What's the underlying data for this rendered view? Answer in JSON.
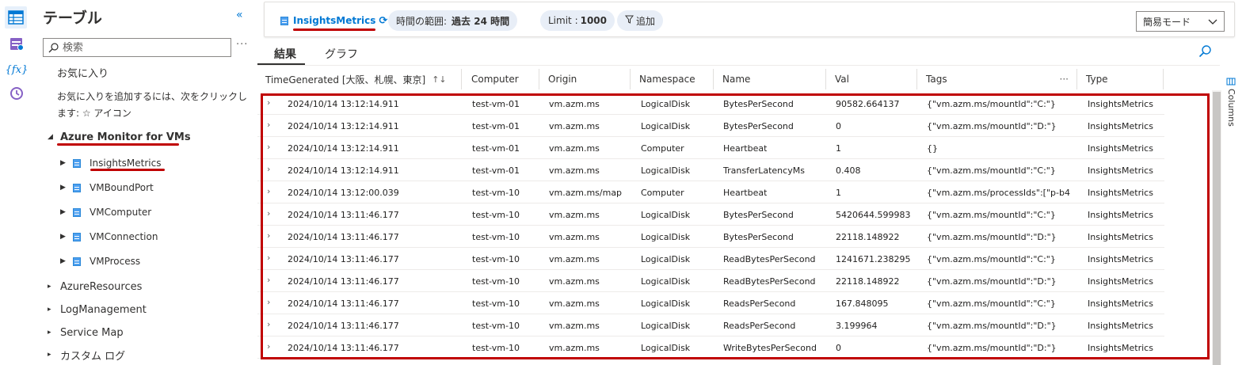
{
  "sidebar_rail": {
    "icons": [
      "tables-icon",
      "queries-icon",
      "functions-icon",
      "history-icon"
    ]
  },
  "schema_panel": {
    "title": "テーブル",
    "search_placeholder": "検索",
    "favorites_title": "お気に入り",
    "favorites_hint": "お気に入りを追加するには、次をクリックします: ☆ アイコン",
    "groups": [
      {
        "label": "Azure Monitor for VMs",
        "expanded": true,
        "tables": [
          "InsightsMetrics",
          "VMBoundPort",
          "VMComputer",
          "VMConnection",
          "VMProcess"
        ]
      },
      {
        "label": "AzureResources",
        "expanded": false
      },
      {
        "label": "LogManagement",
        "expanded": false
      },
      {
        "label": "Service Map",
        "expanded": false
      },
      {
        "label": "カスタム ログ",
        "expanded": false
      }
    ]
  },
  "toolbar": {
    "table_name": "InsightsMetrics",
    "time_range_label": "時間の範囲:",
    "time_range_value": "過去 24 時間",
    "limit_label": "Limit :",
    "limit_value": "1000",
    "add_label": "追加",
    "mode_value": "簡易モード"
  },
  "tabs": [
    "結果",
    "グラフ"
  ],
  "active_tab": "結果",
  "grid": {
    "columns": [
      "TimeGenerated [大阪、札幌、東京]",
      "Computer",
      "Origin",
      "Namespace",
      "Name",
      "Val",
      "Tags",
      "Type"
    ],
    "rows": [
      [
        "2024/10/14 13:12:14.911",
        "test-vm-01",
        "vm.azm.ms",
        "LogicalDisk",
        "BytesPerSecond",
        "90582.664137",
        "{\"vm.azm.ms/mountId\":\"C:\"}",
        "InsightsMetrics"
      ],
      [
        "2024/10/14 13:12:14.911",
        "test-vm-01",
        "vm.azm.ms",
        "LogicalDisk",
        "BytesPerSecond",
        "0",
        "{\"vm.azm.ms/mountId\":\"D:\"}",
        "InsightsMetrics"
      ],
      [
        "2024/10/14 13:12:14.911",
        "test-vm-01",
        "vm.azm.ms",
        "Computer",
        "Heartbeat",
        "1",
        "{}",
        "InsightsMetrics"
      ],
      [
        "2024/10/14 13:12:14.911",
        "test-vm-01",
        "vm.azm.ms",
        "LogicalDisk",
        "TransferLatencyMs",
        "0.408",
        "{\"vm.azm.ms/mountId\":\"C:\"}",
        "InsightsMetrics"
      ],
      [
        "2024/10/14 13:12:00.039",
        "test-vm-10",
        "vm.azm.ms/map",
        "Computer",
        "Heartbeat",
        "1",
        "{\"vm.azm.ms/processIds\":[\"p-b4...",
        "InsightsMetrics"
      ],
      [
        "2024/10/14 13:11:46.177",
        "test-vm-10",
        "vm.azm.ms",
        "LogicalDisk",
        "BytesPerSecond",
        "5420644.599983",
        "{\"vm.azm.ms/mountId\":\"C:\"}",
        "InsightsMetrics"
      ],
      [
        "2024/10/14 13:11:46.177",
        "test-vm-10",
        "vm.azm.ms",
        "LogicalDisk",
        "BytesPerSecond",
        "22118.148922",
        "{\"vm.azm.ms/mountId\":\"D:\"}",
        "InsightsMetrics"
      ],
      [
        "2024/10/14 13:11:46.177",
        "test-vm-10",
        "vm.azm.ms",
        "LogicalDisk",
        "ReadBytesPerSecond",
        "1241671.238295",
        "{\"vm.azm.ms/mountId\":\"C:\"}",
        "InsightsMetrics"
      ],
      [
        "2024/10/14 13:11:46.177",
        "test-vm-10",
        "vm.azm.ms",
        "LogicalDisk",
        "ReadBytesPerSecond",
        "22118.148922",
        "{\"vm.azm.ms/mountId\":\"D:\"}",
        "InsightsMetrics"
      ],
      [
        "2024/10/14 13:11:46.177",
        "test-vm-10",
        "vm.azm.ms",
        "LogicalDisk",
        "ReadsPerSecond",
        "167.848095",
        "{\"vm.azm.ms/mountId\":\"C:\"}",
        "InsightsMetrics"
      ],
      [
        "2024/10/14 13:11:46.177",
        "test-vm-10",
        "vm.azm.ms",
        "LogicalDisk",
        "ReadsPerSecond",
        "3.199964",
        "{\"vm.azm.ms/mountId\":\"D:\"}",
        "InsightsMetrics"
      ],
      [
        "2024/10/14 13:11:46.177",
        "test-vm-10",
        "vm.azm.ms",
        "LogicalDisk",
        "WriteBytesPerSecond",
        "0",
        "{\"vm.azm.ms/mountId\":\"D:\"}",
        "InsightsMetrics"
      ]
    ]
  },
  "columns_panel_label": "Columns",
  "colors": {
    "accent": "#0078d4",
    "annotation_red": "#c00000",
    "chip_background": "#e8eef7"
  }
}
